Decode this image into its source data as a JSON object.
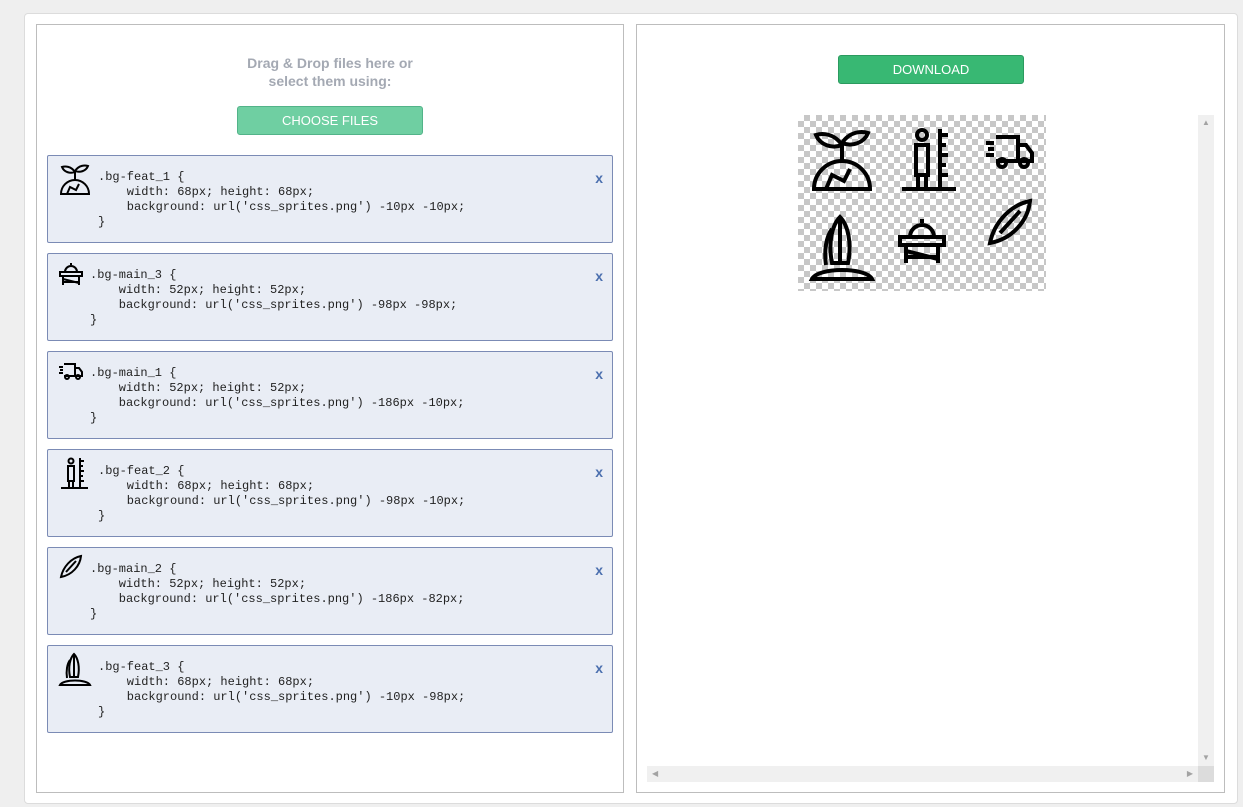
{
  "uploader": {
    "drop_text_line1": "Drag & Drop files here or",
    "drop_text_line2": "select them using:",
    "choose_label": "CHOOSE FILES"
  },
  "css_items": [
    {
      "icon": "sprout-on-globe-icon",
      "code": ".bg-feat_1 {\n    width: 68px; height: 68px;\n    background: url('css_sprites.png') -10px -10px;\n}"
    },
    {
      "icon": "table-saw-icon",
      "code": ".bg-main_3 {\n    width: 52px; height: 52px;\n    background: url('css_sprites.png') -98px -98px;\n}"
    },
    {
      "icon": "delivery-truck-icon",
      "code": ".bg-main_1 {\n    width: 52px; height: 52px;\n    background: url('css_sprites.png') -186px -10px;\n}"
    },
    {
      "icon": "height-measure-icon",
      "code": ".bg-feat_2 {\n    width: 68px; height: 68px;\n    background: url('css_sprites.png') -98px -10px;\n}"
    },
    {
      "icon": "surfboard-icon",
      "code": ".bg-main_2 {\n    width: 52px; height: 52px;\n    background: url('css_sprites.png') -186px -82px;\n}"
    },
    {
      "icon": "surfboards-island-icon",
      "code": ".bg-feat_3 {\n    width: 68px; height: 68px;\n    background: url('css_sprites.png') -10px -98px;\n}"
    }
  ],
  "close_label": "x",
  "output": {
    "download_label": "DOWNLOAD"
  },
  "colors": {
    "choose_button": "#6fcfa2",
    "download_button": "#38b873",
    "item_background": "#e9edf5",
    "item_border": "#7b8bb5",
    "close_x": "#4b6fae"
  }
}
